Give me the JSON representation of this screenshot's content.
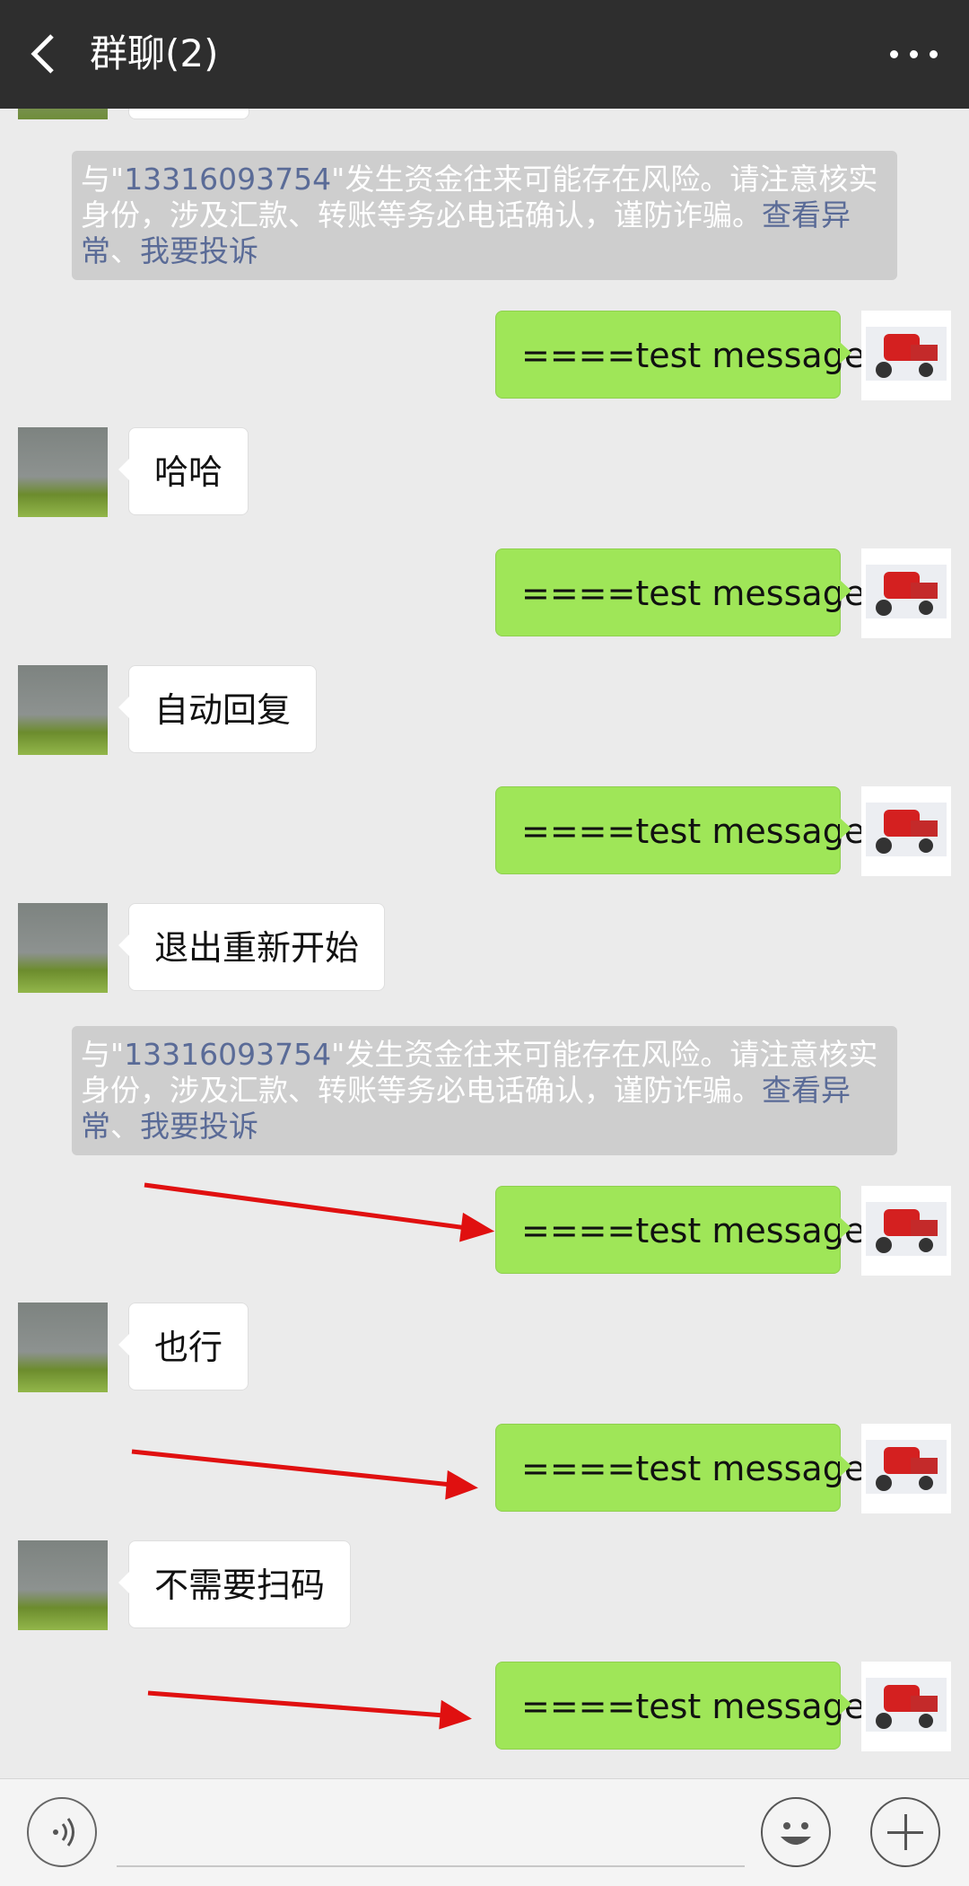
{
  "header": {
    "title": "群聊(2)",
    "back_icon": "back-chevron-icon",
    "more_icon": "more-dots-icon"
  },
  "warning": {
    "prefix": "与\"",
    "number": "13316093754",
    "text": "\"发生资金往来可能存在风险。请注意核实身份，涉及汇款、转账等务必电话确认，谨防诈骗。",
    "link1": "查看异常",
    "sep": "、",
    "link2": "我要投诉"
  },
  "messages": [
    {
      "side": "out",
      "text": "====test message"
    },
    {
      "side": "in",
      "text": "哈哈"
    },
    {
      "side": "out",
      "text": "====test message"
    },
    {
      "side": "in",
      "text": "自动回复"
    },
    {
      "side": "out",
      "text": "====test message"
    },
    {
      "side": "in",
      "text": "退出重新开始"
    },
    {
      "side": "out",
      "text": "====test message"
    },
    {
      "side": "in",
      "text": "也行"
    },
    {
      "side": "out",
      "text": "====test message"
    },
    {
      "side": "in",
      "text": "不需要扫码"
    },
    {
      "side": "out",
      "text": "====test message"
    }
  ],
  "colors": {
    "accent": "#9fe658",
    "annotation_arrow": "#e01010"
  },
  "inputbar": {
    "voice_icon": "voice-icon",
    "emoji_icon": "emoji-icon",
    "plus_icon": "plus-icon"
  }
}
